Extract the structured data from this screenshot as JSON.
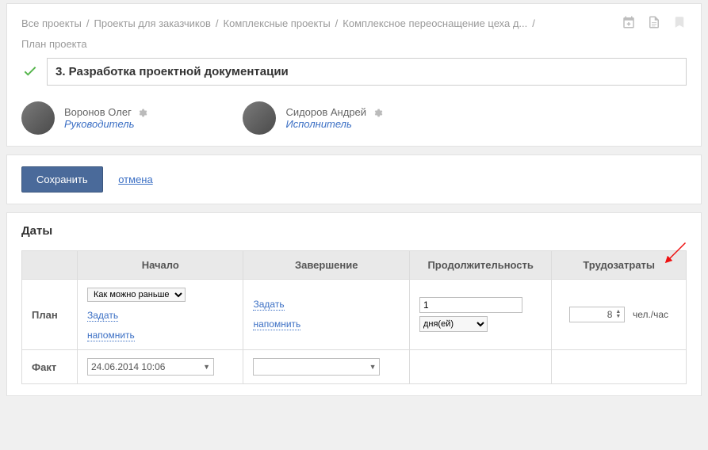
{
  "breadcrumb": {
    "items": [
      "Все проекты",
      "Проекты для заказчиков",
      "Комплексные проекты",
      "Комплексное переоснащение цеха д..."
    ],
    "subtitle": "План проекта"
  },
  "title": "3. Разработка проектной документации",
  "people": [
    {
      "name": "Воронов Олег",
      "role": "Руководитель"
    },
    {
      "name": "Сидоров Андрей",
      "role": "Исполнитель"
    }
  ],
  "actions": {
    "save": "Сохранить",
    "cancel": "отмена"
  },
  "dates": {
    "heading": "Даты",
    "cols": {
      "start": "Начало",
      "finish": "Завершение",
      "duration": "Продолжительность",
      "effort": "Трудозатраты"
    },
    "rows": {
      "plan": "План",
      "fact": "Факт"
    },
    "plan": {
      "start_mode": "Как можно раньше",
      "set_link": "Задать",
      "remind_link": "напомнить",
      "duration_value": "1",
      "duration_unit": "дня(ей)",
      "effort_value": "8",
      "effort_unit": "чел./час"
    },
    "fact": {
      "start_value": "24.06.2014 10:06",
      "finish_value": ""
    }
  }
}
